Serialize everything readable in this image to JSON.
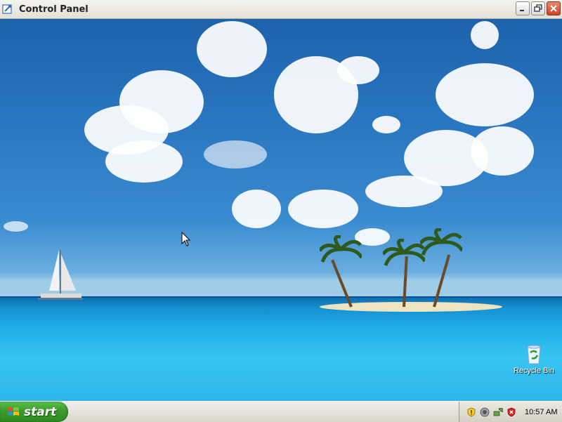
{
  "window": {
    "title": "Control Panel",
    "icon": "control-panel-icon",
    "buttons": [
      "minimize-icon",
      "restore-icon",
      "close-icon"
    ]
  },
  "desktop": {
    "icons": [
      {
        "label": "Recycle Bin",
        "icon": "recycle-bin-icon"
      }
    ]
  },
  "taskbar": {
    "start_label": "start",
    "tray_icons": [
      "security-shield-icon",
      "network-icon",
      "safely-remove-icon",
      "security-center-icon"
    ],
    "clock": "10:57 AM"
  },
  "colors": {
    "start_green": "#3a9b2b",
    "titlebar": "#e3e0d6",
    "close_red": "#c9452a"
  }
}
